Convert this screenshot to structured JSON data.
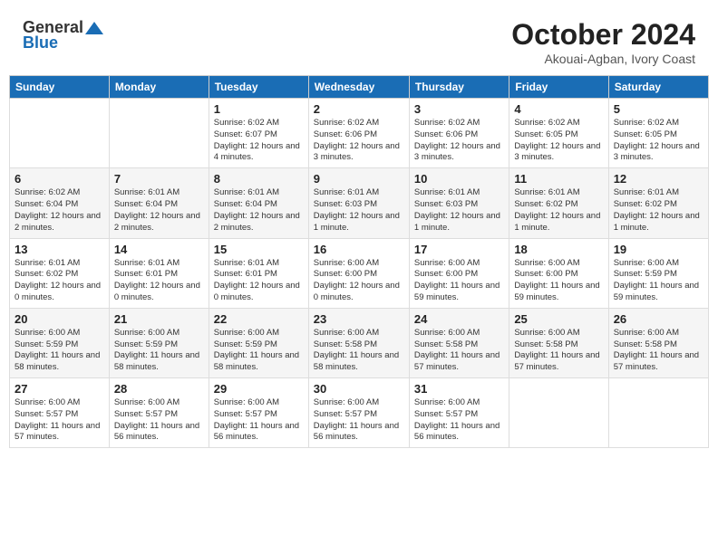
{
  "logo": {
    "general": "General",
    "blue": "Blue"
  },
  "title": {
    "month": "October 2024",
    "location": "Akouai-Agban, Ivory Coast"
  },
  "headers": [
    "Sunday",
    "Monday",
    "Tuesday",
    "Wednesday",
    "Thursday",
    "Friday",
    "Saturday"
  ],
  "weeks": [
    [
      {
        "day": "",
        "info": ""
      },
      {
        "day": "",
        "info": ""
      },
      {
        "day": "1",
        "info": "Sunrise: 6:02 AM\nSunset: 6:07 PM\nDaylight: 12 hours and 4 minutes."
      },
      {
        "day": "2",
        "info": "Sunrise: 6:02 AM\nSunset: 6:06 PM\nDaylight: 12 hours and 3 minutes."
      },
      {
        "day": "3",
        "info": "Sunrise: 6:02 AM\nSunset: 6:06 PM\nDaylight: 12 hours and 3 minutes."
      },
      {
        "day": "4",
        "info": "Sunrise: 6:02 AM\nSunset: 6:05 PM\nDaylight: 12 hours and 3 minutes."
      },
      {
        "day": "5",
        "info": "Sunrise: 6:02 AM\nSunset: 6:05 PM\nDaylight: 12 hours and 3 minutes."
      }
    ],
    [
      {
        "day": "6",
        "info": "Sunrise: 6:02 AM\nSunset: 6:04 PM\nDaylight: 12 hours and 2 minutes."
      },
      {
        "day": "7",
        "info": "Sunrise: 6:01 AM\nSunset: 6:04 PM\nDaylight: 12 hours and 2 minutes."
      },
      {
        "day": "8",
        "info": "Sunrise: 6:01 AM\nSunset: 6:04 PM\nDaylight: 12 hours and 2 minutes."
      },
      {
        "day": "9",
        "info": "Sunrise: 6:01 AM\nSunset: 6:03 PM\nDaylight: 12 hours and 1 minute."
      },
      {
        "day": "10",
        "info": "Sunrise: 6:01 AM\nSunset: 6:03 PM\nDaylight: 12 hours and 1 minute."
      },
      {
        "day": "11",
        "info": "Sunrise: 6:01 AM\nSunset: 6:02 PM\nDaylight: 12 hours and 1 minute."
      },
      {
        "day": "12",
        "info": "Sunrise: 6:01 AM\nSunset: 6:02 PM\nDaylight: 12 hours and 1 minute."
      }
    ],
    [
      {
        "day": "13",
        "info": "Sunrise: 6:01 AM\nSunset: 6:02 PM\nDaylight: 12 hours and 0 minutes."
      },
      {
        "day": "14",
        "info": "Sunrise: 6:01 AM\nSunset: 6:01 PM\nDaylight: 12 hours and 0 minutes."
      },
      {
        "day": "15",
        "info": "Sunrise: 6:01 AM\nSunset: 6:01 PM\nDaylight: 12 hours and 0 minutes."
      },
      {
        "day": "16",
        "info": "Sunrise: 6:00 AM\nSunset: 6:00 PM\nDaylight: 12 hours and 0 minutes."
      },
      {
        "day": "17",
        "info": "Sunrise: 6:00 AM\nSunset: 6:00 PM\nDaylight: 11 hours and 59 minutes."
      },
      {
        "day": "18",
        "info": "Sunrise: 6:00 AM\nSunset: 6:00 PM\nDaylight: 11 hours and 59 minutes."
      },
      {
        "day": "19",
        "info": "Sunrise: 6:00 AM\nSunset: 5:59 PM\nDaylight: 11 hours and 59 minutes."
      }
    ],
    [
      {
        "day": "20",
        "info": "Sunrise: 6:00 AM\nSunset: 5:59 PM\nDaylight: 11 hours and 58 minutes."
      },
      {
        "day": "21",
        "info": "Sunrise: 6:00 AM\nSunset: 5:59 PM\nDaylight: 11 hours and 58 minutes."
      },
      {
        "day": "22",
        "info": "Sunrise: 6:00 AM\nSunset: 5:59 PM\nDaylight: 11 hours and 58 minutes."
      },
      {
        "day": "23",
        "info": "Sunrise: 6:00 AM\nSunset: 5:58 PM\nDaylight: 11 hours and 58 minutes."
      },
      {
        "day": "24",
        "info": "Sunrise: 6:00 AM\nSunset: 5:58 PM\nDaylight: 11 hours and 57 minutes."
      },
      {
        "day": "25",
        "info": "Sunrise: 6:00 AM\nSunset: 5:58 PM\nDaylight: 11 hours and 57 minutes."
      },
      {
        "day": "26",
        "info": "Sunrise: 6:00 AM\nSunset: 5:58 PM\nDaylight: 11 hours and 57 minutes."
      }
    ],
    [
      {
        "day": "27",
        "info": "Sunrise: 6:00 AM\nSunset: 5:57 PM\nDaylight: 11 hours and 57 minutes."
      },
      {
        "day": "28",
        "info": "Sunrise: 6:00 AM\nSunset: 5:57 PM\nDaylight: 11 hours and 56 minutes."
      },
      {
        "day": "29",
        "info": "Sunrise: 6:00 AM\nSunset: 5:57 PM\nDaylight: 11 hours and 56 minutes."
      },
      {
        "day": "30",
        "info": "Sunrise: 6:00 AM\nSunset: 5:57 PM\nDaylight: 11 hours and 56 minutes."
      },
      {
        "day": "31",
        "info": "Sunrise: 6:00 AM\nSunset: 5:57 PM\nDaylight: 11 hours and 56 minutes."
      },
      {
        "day": "",
        "info": ""
      },
      {
        "day": "",
        "info": ""
      }
    ]
  ]
}
